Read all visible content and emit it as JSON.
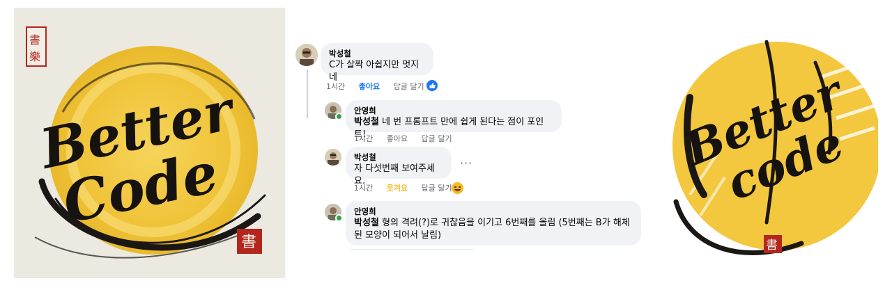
{
  "logo": {
    "line1": "Better",
    "line2": "Code",
    "line2_right": "code"
  },
  "comments": [
    {
      "author": "박성철",
      "text": "C가 살짝 아쉽지만 멋지네",
      "time": "1시간",
      "like_label": "좋아요",
      "reply_label": "답글 달기",
      "reaction_icon": "like-icon"
    },
    {
      "author": "안영희",
      "mention": "박성철",
      "text": " 네 번 프롬프트 만에 쉽게 된다는 점이 포인트!",
      "time": "1시간",
      "like_label": "좋아요",
      "reply_label": "답글 달기"
    },
    {
      "author": "박성철",
      "text": "자 다섯번째 보여주세요.",
      "time": "1시간",
      "like_label": "웃겨요",
      "reply_label": "답글 달기",
      "reaction_icon": "haha-icon",
      "more": "···"
    },
    {
      "author": "안영희",
      "mention": "박성철",
      "text_line1": " 형의 격려(?)로 귀찮음을 이기고 6번째를 올림 (5번째는 B가 해체",
      "text_line2": "된 모양이 되어서 날림)"
    }
  ],
  "colors": {
    "like_blue": "#1877f2",
    "haha_yellow": "#f7b928",
    "bubble_bg": "#f0f2f5",
    "meta_gray": "#65676b",
    "logo_yellow": "#f2c53d",
    "seal_red": "#b3261e"
  }
}
